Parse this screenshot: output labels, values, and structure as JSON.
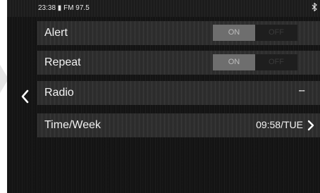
{
  "status_bar": {
    "time_text": "23:38 ▮ FM 97.5",
    "bluetooth_icon": "bluetooth-icon"
  },
  "navigation": {
    "back_icon": "chevron-left-icon"
  },
  "settings": {
    "alert": {
      "label": "Alert",
      "on_label": "ON",
      "off_label": "OFF",
      "state": "on"
    },
    "repeat": {
      "label": "Repeat",
      "on_label": "ON",
      "off_label": "OFF",
      "state": "on"
    },
    "radio": {
      "label": "Radio",
      "value": "--"
    },
    "time_week": {
      "label": "Time/Week",
      "value": "09:58/TUE",
      "arrow_icon": "chevron-right-icon"
    }
  },
  "colors": {
    "screen_background": "#141414",
    "row_background": "#2e2e2e",
    "toggle_on": "#6e6e6e",
    "toggle_off": "#1e1e1e",
    "text": "#f2f2f2"
  }
}
